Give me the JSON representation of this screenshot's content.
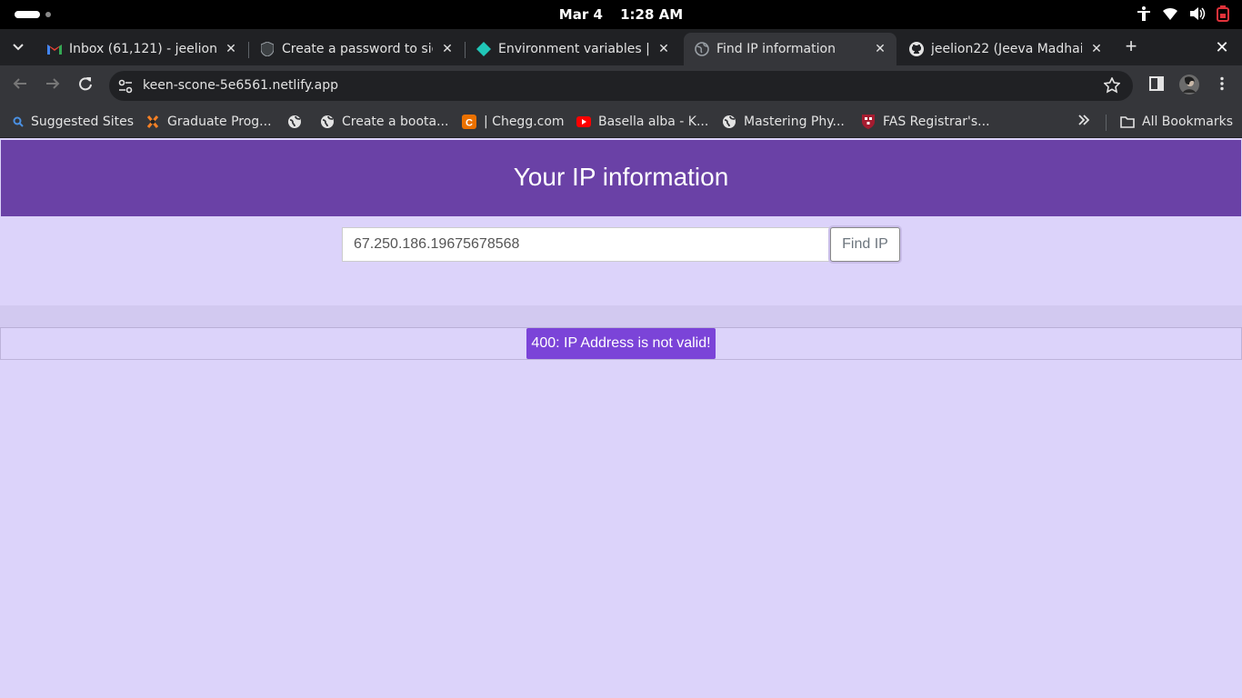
{
  "system": {
    "date": "Mar 4",
    "time": "1:28 AM"
  },
  "tabs": [
    {
      "title": "Inbox (61,121) - jeelion22@",
      "icon": "gmail-icon",
      "active": false
    },
    {
      "title": "Create a password to sign",
      "icon": "shield-icon",
      "active": false
    },
    {
      "title": "Environment variables | S",
      "icon": "netlify-icon",
      "active": false
    },
    {
      "title": "Find IP information",
      "icon": "globe-icon",
      "active": true
    },
    {
      "title": "jeelion22 (Jeeva Madhaiyan",
      "icon": "github-icon",
      "active": false
    }
  ],
  "toolbar": {
    "url": "keen-scone-5e6561.netlify.app"
  },
  "bookmarks": [
    {
      "label": "Suggested Sites",
      "icon": "search-icon"
    },
    {
      "label": "Graduate Prog...",
      "icon": "princeton-icon"
    },
    {
      "label": "",
      "icon": "globe-icon"
    },
    {
      "label": "Create a boota...",
      "icon": "globe-icon"
    },
    {
      "label": "| Chegg.com",
      "icon": "chegg-icon"
    },
    {
      "label": "Basella alba - K...",
      "icon": "youtube-icon"
    },
    {
      "label": "Mastering Phy...",
      "icon": "globe-icon"
    },
    {
      "label": "FAS Registrar's...",
      "icon": "harvard-shield-icon"
    }
  ],
  "bookmarks_folder": "All Bookmarks",
  "page": {
    "heading": "Your IP information",
    "ip_value": "67.250.186.19675678568",
    "find_button": "Find IP",
    "error_message": "400: IP Address is not valid!"
  },
  "colors": {
    "hero": "#6a41a6",
    "page_bg": "#dcd3fa",
    "error_badge": "#7b44d8"
  }
}
